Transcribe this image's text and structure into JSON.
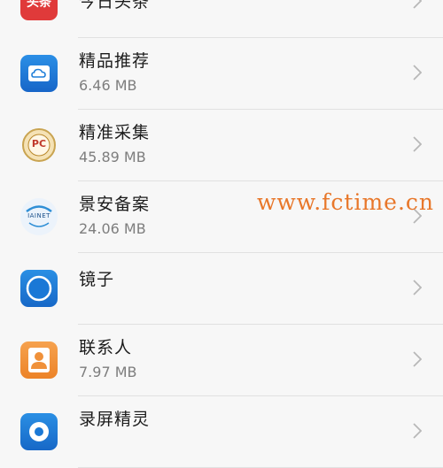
{
  "apps": [
    {
      "name": "今日头条",
      "size": "",
      "icon": "toutiao-logo-icon",
      "icon_text": "头条"
    },
    {
      "name": "精品推荐",
      "size": "6.46 MB",
      "icon": "cloud-icon"
    },
    {
      "name": "精准采集",
      "size": "45.89 MB",
      "icon": "pc-badge-icon",
      "icon_text": "PC"
    },
    {
      "name": "景安备案",
      "size": "24.06 MB",
      "icon": "zzidc-logo-icon",
      "icon_text": "IAINET"
    },
    {
      "name": "镜子",
      "size": "",
      "icon": "mirror-icon"
    },
    {
      "name": "联系人",
      "size": "7.97 MB",
      "icon": "contacts-icon"
    },
    {
      "name": "录屏精灵",
      "size": "",
      "icon": "screen-recorder-icon"
    }
  ],
  "watermark": "www.fctime.cn",
  "colors": {
    "background": "#f7f7f7",
    "watermark": "#e8772a",
    "toutiao_red": "#e03a3a",
    "blue": "#1f7ed8",
    "contacts_orange": "#f0913a"
  }
}
